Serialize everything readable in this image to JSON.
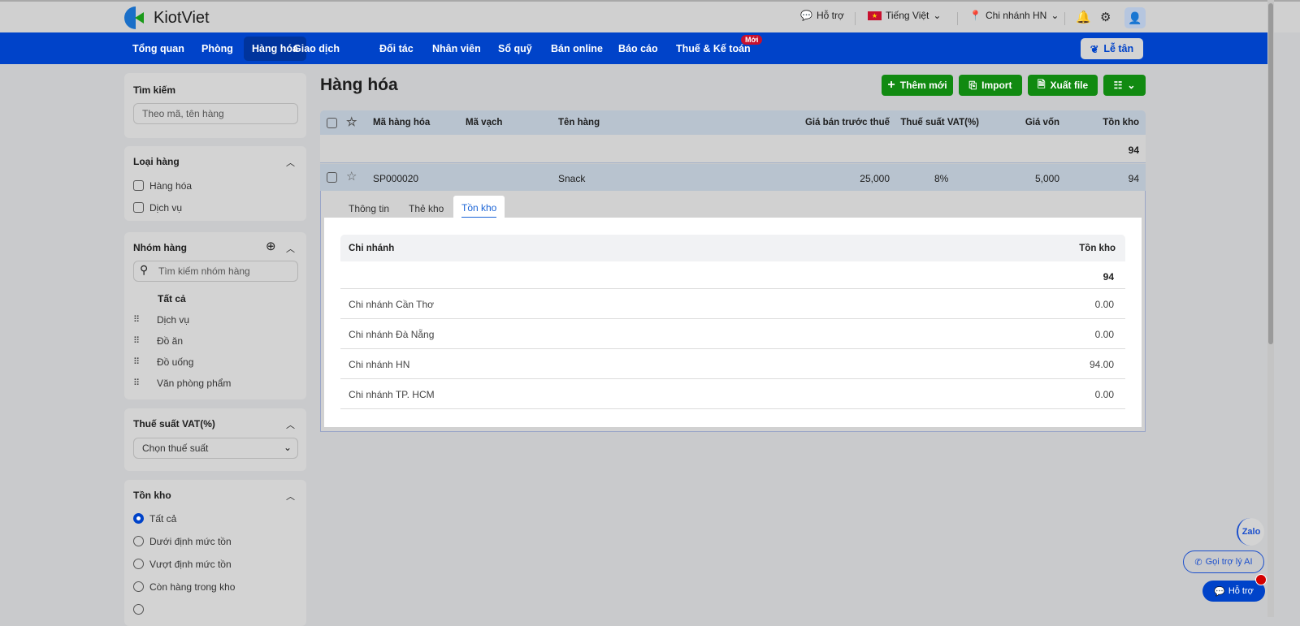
{
  "header": {
    "brand": "KiotViet",
    "support": "Hỗ trợ",
    "language": "Tiếng Việt",
    "branch": "Chi nhánh HN"
  },
  "nav": {
    "items": [
      "Tổng quan",
      "Phòng",
      "Hàng hóa",
      "Giao dịch",
      "Đối tác",
      "Nhân viên",
      "Sổ quỹ",
      "Bán online",
      "Báo cáo",
      "Thuế & Kế toán"
    ],
    "active": "Hàng hóa",
    "new_badge": "Mới",
    "reception": "Lễ tân"
  },
  "sidebar": {
    "search": {
      "title": "Tìm kiếm",
      "placeholder": "Theo mã, tên hàng"
    },
    "type": {
      "title": "Loại hàng",
      "options": [
        "Hàng hóa",
        "Dịch vụ"
      ]
    },
    "group": {
      "title": "Nhóm hàng",
      "placeholder": "Tìm kiếm nhóm hàng",
      "all": "Tất cả",
      "items": [
        "Dịch vụ",
        "Đồ ăn",
        "Đồ uống",
        "Văn phòng phẩm"
      ]
    },
    "vat": {
      "title": "Thuế suất VAT(%)",
      "placeholder": "Chọn thuế suất"
    },
    "stock": {
      "title": "Tồn kho",
      "options": [
        "Tất cả",
        "Dưới định mức tồn",
        "Vượt định mức tồn",
        "Còn hàng trong kho"
      ],
      "selected": "Tất cả"
    }
  },
  "main": {
    "title": "Hàng hóa",
    "buttons": {
      "add": "Thêm mới",
      "import": "Import",
      "export": "Xuất file"
    },
    "columns": [
      "Mã hàng hóa",
      "Mã vạch",
      "Tên hàng",
      "Giá bán trước thuế",
      "Thuế suất VAT(%)",
      "Giá vốn",
      "Tồn kho"
    ],
    "total_stock": "94",
    "row": {
      "code": "SP000020",
      "barcode": "",
      "name": "Snack",
      "price": "25,000",
      "vat": "8%",
      "cost": "5,000",
      "stock": "94"
    },
    "detail": {
      "tabs": [
        "Thông tin",
        "Thẻ kho",
        "Tồn kho"
      ],
      "active_tab": "Tồn kho",
      "columns": [
        "Chi nhánh",
        "Tồn kho"
      ],
      "total": "94",
      "rows": [
        {
          "branch": "Chi nhánh Cần Thơ",
          "stock": "0.00"
        },
        {
          "branch": "Chi nhánh Đà Nẵng",
          "stock": "0.00"
        },
        {
          "branch": "Chi nhánh HN",
          "stock": "94.00"
        },
        {
          "branch": "Chi nhánh TP. HCM",
          "stock": "0.00"
        }
      ]
    }
  },
  "floating": {
    "zalo": "Zalo",
    "ai": "Gọi trợ lý AI",
    "support": "Hỗ trợ"
  }
}
